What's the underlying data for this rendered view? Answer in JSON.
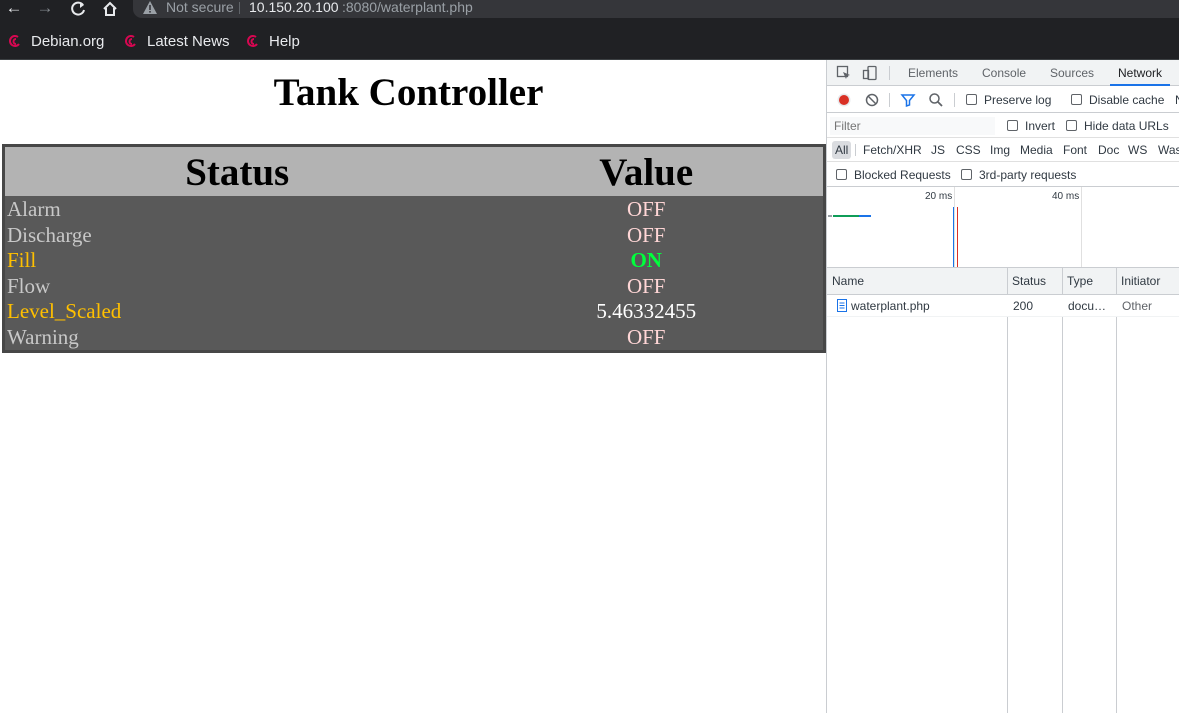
{
  "browser": {
    "security_label": "Not secure",
    "url_host": "10.150.20.100",
    "url_path": ":8080/waterplant.php",
    "bookmarks": [
      {
        "label": "Debian.org"
      },
      {
        "label": "Latest News"
      },
      {
        "label": "Help"
      }
    ]
  },
  "page": {
    "title": "Tank Controller",
    "table": {
      "headers": [
        "Status",
        "Value"
      ],
      "rows": [
        {
          "status": "Alarm",
          "value": "OFF",
          "status_color": "#c8c8c8",
          "value_color": "#ffd6d6",
          "value_bold": false
        },
        {
          "status": "Discharge",
          "value": "OFF",
          "status_color": "#c8c8c8",
          "value_color": "#ffd6d6",
          "value_bold": false
        },
        {
          "status": "Fill",
          "value": "ON",
          "status_color": "#ffc000",
          "value_color": "#00ff3c",
          "value_bold": true
        },
        {
          "status": "Flow",
          "value": "OFF",
          "status_color": "#c8c8c8",
          "value_color": "#ffd6d6",
          "value_bold": false
        },
        {
          "status": "Level_Scaled",
          "value": "5.46332455",
          "status_color": "#ffc000",
          "value_color": "#ffffff",
          "value_bold": false
        },
        {
          "status": "Warning",
          "value": "OFF",
          "status_color": "#c8c8c8",
          "value_color": "#ffd6d6",
          "value_bold": false
        }
      ]
    }
  },
  "devtools": {
    "tabs": [
      "Elements",
      "Console",
      "Sources",
      "Network"
    ],
    "active_tab": "Network",
    "preserve_log": "Preserve log",
    "disable_cache": "Disable cache",
    "overflow_glyph": "N",
    "filter_placeholder": "Filter",
    "invert": "Invert",
    "hide_data_urls": "Hide data URLs",
    "types": [
      "All",
      "Fetch/XHR",
      "JS",
      "CSS",
      "Img",
      "Media",
      "Font",
      "Doc",
      "WS",
      "Was"
    ],
    "blocked_requests": "Blocked Requests",
    "third_party": "3rd-party requests",
    "timeline_labels": [
      "20 ms",
      "40 ms"
    ],
    "columns": [
      "Name",
      "Status",
      "Type",
      "Initiator"
    ],
    "requests": [
      {
        "name": "waterplant.php",
        "status": "200",
        "type": "docu…",
        "initiator": "Other"
      }
    ]
  }
}
